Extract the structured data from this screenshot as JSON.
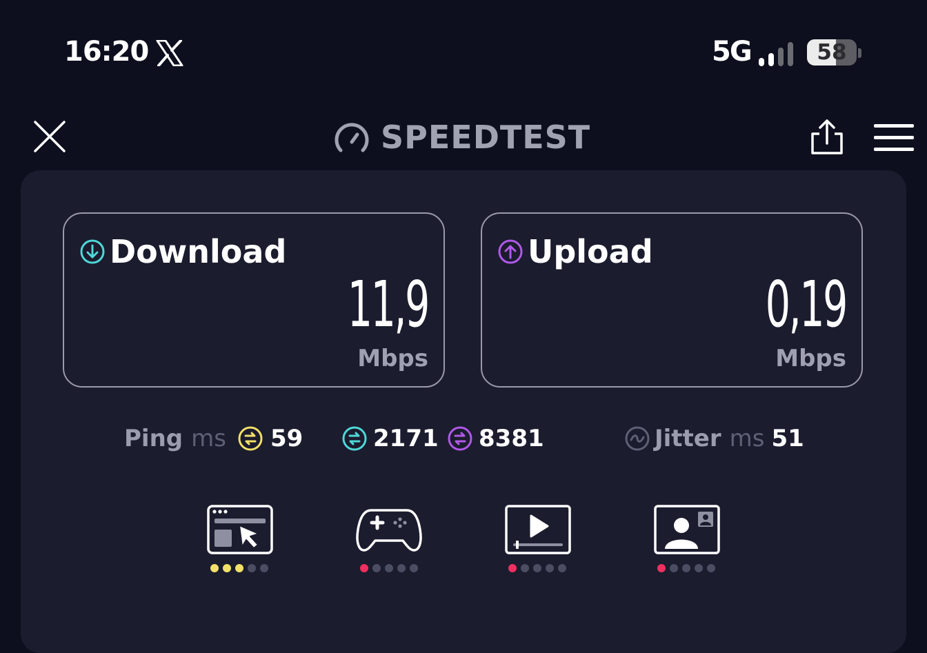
{
  "status_bar": {
    "time": "16:20",
    "network": "5G",
    "battery_percent": "58",
    "battery_level": 0.58,
    "signal_bars_active": 2,
    "notification_icon": "x-logo-icon"
  },
  "header": {
    "title": "SPEEDTEST",
    "close_icon": "close-icon",
    "share_icon": "share-icon",
    "menu_icon": "hamburger-menu-icon"
  },
  "download": {
    "label": "Download",
    "value": "11,9",
    "unit": "Mbps",
    "accent": "#4fd8d8"
  },
  "upload": {
    "label": "Upload",
    "value": "0,19",
    "unit": "Mbps",
    "accent": "#b159ea"
  },
  "ping": {
    "label": "Ping",
    "unit": "ms",
    "idle": "59",
    "download": "2171",
    "upload": "8381",
    "colors": {
      "idle": "#f2e166",
      "download": "#4fd8d8",
      "upload": "#b159ea"
    }
  },
  "jitter": {
    "label": "Jitter",
    "unit": "ms",
    "value": "51"
  },
  "activities": [
    {
      "name": "web-browsing-icon",
      "rating": 3,
      "rating_color": "#f2e166"
    },
    {
      "name": "gaming-controller-icon",
      "rating": 1,
      "rating_color": "#ee2f5f"
    },
    {
      "name": "video-streaming-icon",
      "rating": 1,
      "rating_color": "#ee2f5f"
    },
    {
      "name": "video-call-icon",
      "rating": 1,
      "rating_color": "#ee2f5f"
    }
  ],
  "colors": {
    "background": "#0d0f1e",
    "panel": "#1b1c2e",
    "muted_text": "#9b9cad"
  }
}
